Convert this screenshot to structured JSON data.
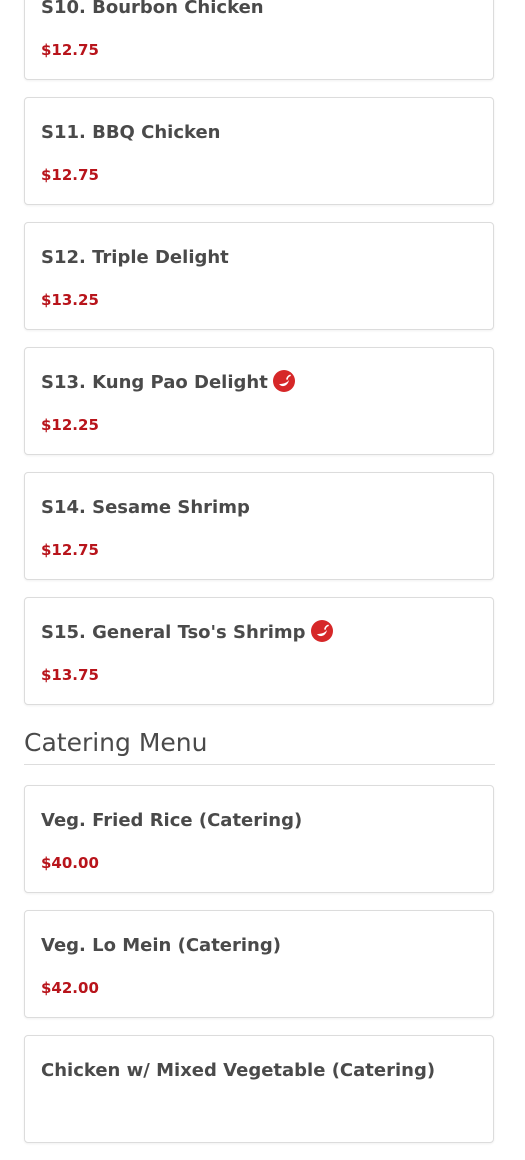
{
  "sections": [
    {
      "title": "",
      "items": [
        {
          "name": "S10. Bourbon Chicken",
          "price": "$12.75",
          "spicy": false
        },
        {
          "name": "S11. BBQ Chicken",
          "price": "$12.75",
          "spicy": false
        },
        {
          "name": "S12. Triple Delight",
          "price": "$13.25",
          "spicy": false
        },
        {
          "name": "S13. Kung Pao Delight",
          "price": "$12.25",
          "spicy": true
        },
        {
          "name": "S14. Sesame Shrimp",
          "price": "$12.75",
          "spicy": false
        },
        {
          "name": "S15. General Tso's Shrimp",
          "price": "$13.75",
          "spicy": true
        }
      ]
    },
    {
      "title": "Catering Menu",
      "items": [
        {
          "name": "Veg. Fried Rice (Catering)",
          "price": "$40.00",
          "spicy": false
        },
        {
          "name": "Veg. Lo Mein (Catering)",
          "price": "$42.00",
          "spicy": false
        },
        {
          "name": "Chicken w/ Mixed Vegetable (Catering)",
          "price": "",
          "spicy": false
        }
      ]
    }
  ],
  "colors": {
    "price": "#b8141b",
    "spicy_icon": "#d62728",
    "text": "#4a4a4a",
    "card_border": "#dcdcdc"
  },
  "icons": {
    "spicy": "chili-pepper-icon"
  }
}
